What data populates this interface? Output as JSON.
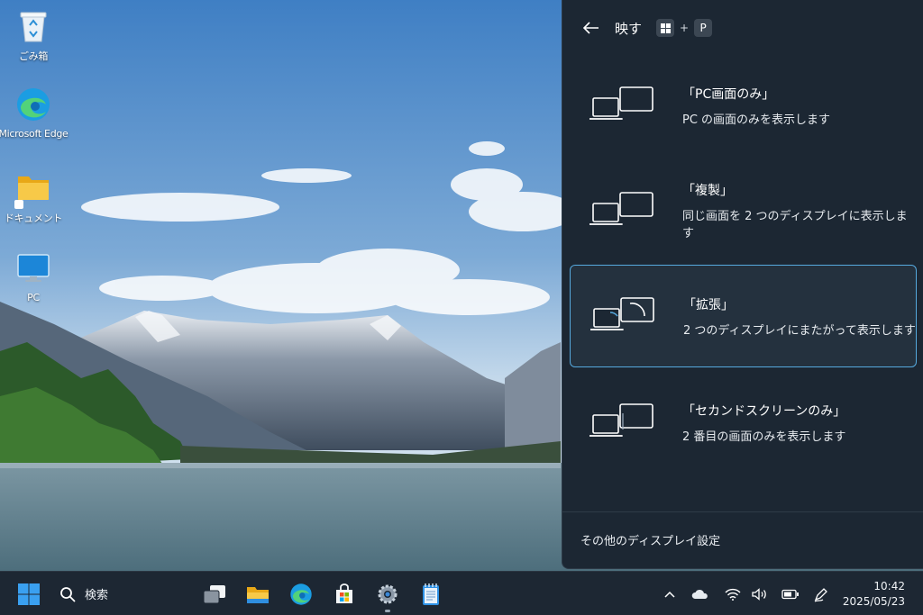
{
  "desktop": {
    "icons": [
      {
        "label": "ごみ箱",
        "icon": "recycle-bin-icon"
      },
      {
        "label": "Microsoft Edge",
        "icon": "edge-icon"
      },
      {
        "label": "ドキュメント",
        "icon": "folder-icon"
      },
      {
        "label": "PC",
        "icon": "monitor-icon"
      }
    ]
  },
  "project": {
    "title": "映す",
    "shortcut_key2": "P",
    "shortcut_plus": "+",
    "options": [
      {
        "title": "「PC画面のみ」",
        "desc": "PC の画面のみを表示します",
        "selected": false
      },
      {
        "title": "「複製」",
        "desc": "同じ画面を 2 つのディスプレイに表示します",
        "selected": false
      },
      {
        "title": "「拡張」",
        "desc": "2 つのディスプレイにまたがって表示します",
        "selected": true
      },
      {
        "title": "「セカンドスクリーンのみ」",
        "desc": "2 番目の画面のみを表示します",
        "selected": false
      }
    ],
    "footer": "その他のディスプレイ設定",
    "accent": "#56a9de"
  },
  "taskbar": {
    "search_label": "検索",
    "apps": [
      "task-view-icon",
      "file-explorer-icon",
      "edge-icon",
      "store-icon",
      "settings-icon",
      "notepad-icon"
    ],
    "tray": [
      "chevron-up-icon",
      "cloud-icon",
      "wifi-icon",
      "volume-icon",
      "battery-icon",
      "pen-icon"
    ],
    "time": "10:42",
    "date": "2025/05/23"
  }
}
